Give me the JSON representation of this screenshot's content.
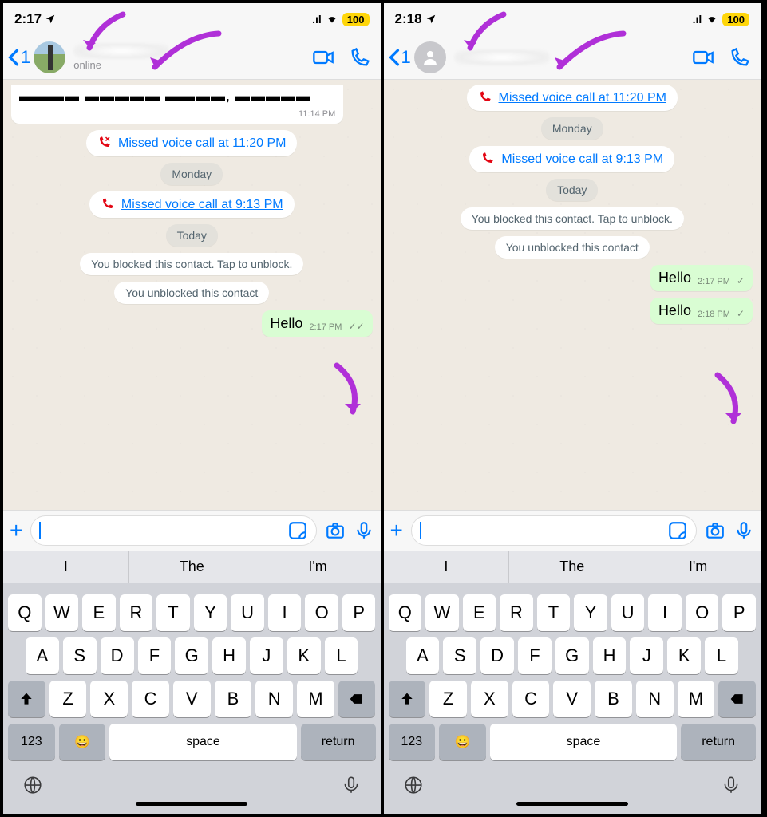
{
  "left": {
    "status": {
      "time": "2:17",
      "battery": "100"
    },
    "nav": {
      "back_count": "1",
      "status_text": "online"
    },
    "cut_message": {
      "text": "Plaza Premium lounge, Bengaluru",
      "time": "11:14 PM"
    },
    "missed1": "Missed voice call at 11:20 PM",
    "day1": "Monday",
    "missed2": "Missed voice call at 9:13 PM",
    "day2": "Today",
    "blocked": "You blocked this contact. Tap to unblock.",
    "unblocked": "You unblocked this contact",
    "out1": {
      "text": "Hello",
      "time": "2:17 PM"
    }
  },
  "right": {
    "status": {
      "time": "2:18",
      "battery": "100"
    },
    "nav": {
      "back_count": "1"
    },
    "missed1": "Missed voice call at 11:20 PM",
    "day1": "Monday",
    "missed2": "Missed voice call at 9:13 PM",
    "day2": "Today",
    "blocked": "You blocked this contact. Tap to unblock.",
    "unblocked": "You unblocked this contact",
    "out1": {
      "text": "Hello",
      "time": "2:17 PM"
    },
    "out2": {
      "text": "Hello",
      "time": "2:18 PM"
    }
  },
  "keyboard": {
    "suggestions": [
      "I",
      "The",
      "I'm"
    ],
    "row1": [
      "Q",
      "W",
      "E",
      "R",
      "T",
      "Y",
      "U",
      "I",
      "O",
      "P"
    ],
    "row2": [
      "A",
      "S",
      "D",
      "F",
      "G",
      "H",
      "J",
      "K",
      "L"
    ],
    "row3": [
      "Z",
      "X",
      "C",
      "V",
      "B",
      "N",
      "M"
    ],
    "numkey": "123",
    "space": "space",
    "return": "return"
  }
}
